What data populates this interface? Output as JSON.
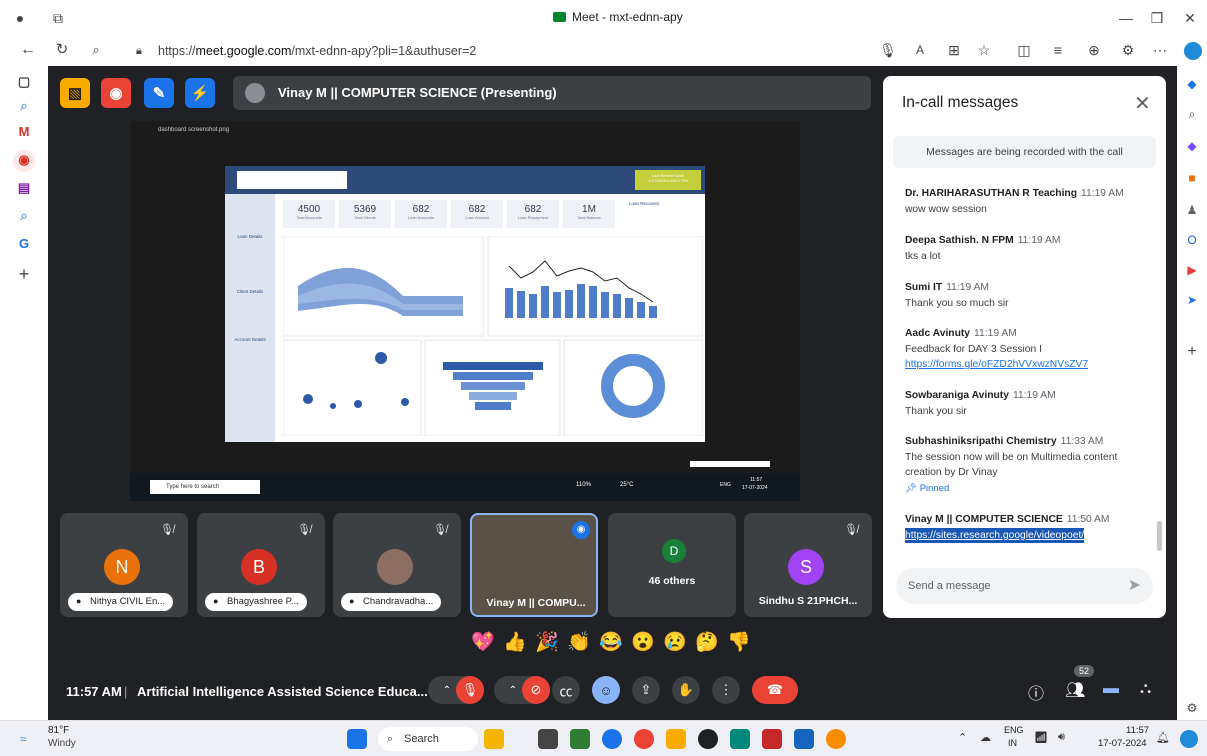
{
  "browser": {
    "tab_title": "Meet - mxt-ednn-apy",
    "url_prefix": "https://",
    "url_host": "meet.google.com",
    "url_path": "/mxt-ednn-apy?pli=1&authuser=2"
  },
  "presenter_bar": {
    "label": "Vinay M || COMPUTER SCIENCE (Presenting)"
  },
  "shared_screen": {
    "window_title": "dashboard screenshot.png",
    "kpis": [
      {
        "value": "4500",
        "label": "Total Accounts"
      },
      {
        "value": "5369",
        "label": "Total Clients"
      },
      {
        "value": "682",
        "label": "Loan Accounts"
      },
      {
        "value": "682",
        "label": "Loan Amount"
      },
      {
        "value": "682",
        "label": "Loan Repayment"
      },
      {
        "value": "1M",
        "label": "Total Balance"
      }
    ],
    "side_nav": [
      "Loan Details",
      "Client Details",
      "Account Details"
    ],
    "charts": [
      "Loans by Year and Duration (in Months)",
      "12 Months Amount and Payments Trend",
      "Loan Amount and Payments by Year",
      "Payments by Year",
      "Loans by Purpose"
    ],
    "refresh_label": "Last Refresh Date",
    "refresh_value": "1/17/2025 6:43:27 PM",
    "loan_recovery": "Loan Recovery",
    "search_placeholder": "Type here to search",
    "zoom": "110%",
    "temp": "25°C",
    "lang": "ENG",
    "time": "11:57",
    "date": "17-07-2024"
  },
  "chat": {
    "title": "In-call messages",
    "notice": "Messages are being recorded with the call",
    "messages": [
      {
        "who": "Dr. HARIHARASUTHAN R Teaching",
        "time": "11:19 AM",
        "lines": [
          "wow wow session"
        ]
      },
      {
        "who": "Deepa Sathish. N FPM",
        "time": "11:19 AM",
        "lines": [
          "tks a lot"
        ]
      },
      {
        "who": "Sumi IT",
        "time": "11:19 AM",
        "lines": [
          "Thank you so much sir"
        ]
      },
      {
        "who": "Aadc Avinuty",
        "time": "11:19 AM",
        "lines": [
          "Feedback for DAY 3 Session I"
        ],
        "link": "https://forms.gle/oFZD2hVVxwzNVsZV7"
      },
      {
        "who": "Sowbaraniga Avinuty",
        "time": "11:19 AM",
        "lines": [
          "Thank you sir"
        ]
      },
      {
        "who": "Subhashiniksripathi Chemistry",
        "time": "11:33 AM",
        "lines": [
          "The session now will be on Multimedia content",
          "creation by Dr Vinay"
        ],
        "pinned": "Pinned"
      },
      {
        "who": "Vinay M || COMPUTER SCIENCE",
        "time": "11:50 AM",
        "link": "https://sites.research.google/videopoet/"
      }
    ],
    "input_placeholder": "Send a message"
  },
  "tiles": [
    {
      "initial": "N",
      "color": "#e8710a",
      "name": "Nithya CIVIL En..."
    },
    {
      "initial": "B",
      "color": "#d93025",
      "name": "Bhagyashree P..."
    },
    {
      "initial": "",
      "color": "#8d6e63",
      "name": "Chandravadha..."
    },
    {
      "initial": "",
      "color": "#5f6368",
      "name": "Vinay M || COMPU..."
    },
    {
      "initial": "D",
      "color": "#188038",
      "name": "46 others"
    },
    {
      "initial": "S",
      "color": "#a142f4",
      "name": "Sindhu S 21PHCH..."
    }
  ],
  "reactions": [
    "💖",
    "👍",
    "🎉",
    "👏",
    "😂",
    "😮",
    "😢",
    "🤔",
    "👎"
  ],
  "bottom_bar": {
    "time": "11:57 AM",
    "separator": "|",
    "meeting_title": "Artificial Intelligence Assisted Science Educa...",
    "participants_count": "52"
  },
  "windows_taskbar": {
    "weather_temp": "81°F",
    "weather_desc": "Windy",
    "search": "Search",
    "lang": "ENG",
    "lang2": "IN",
    "time": "11:57",
    "date": "17-07-2024"
  }
}
